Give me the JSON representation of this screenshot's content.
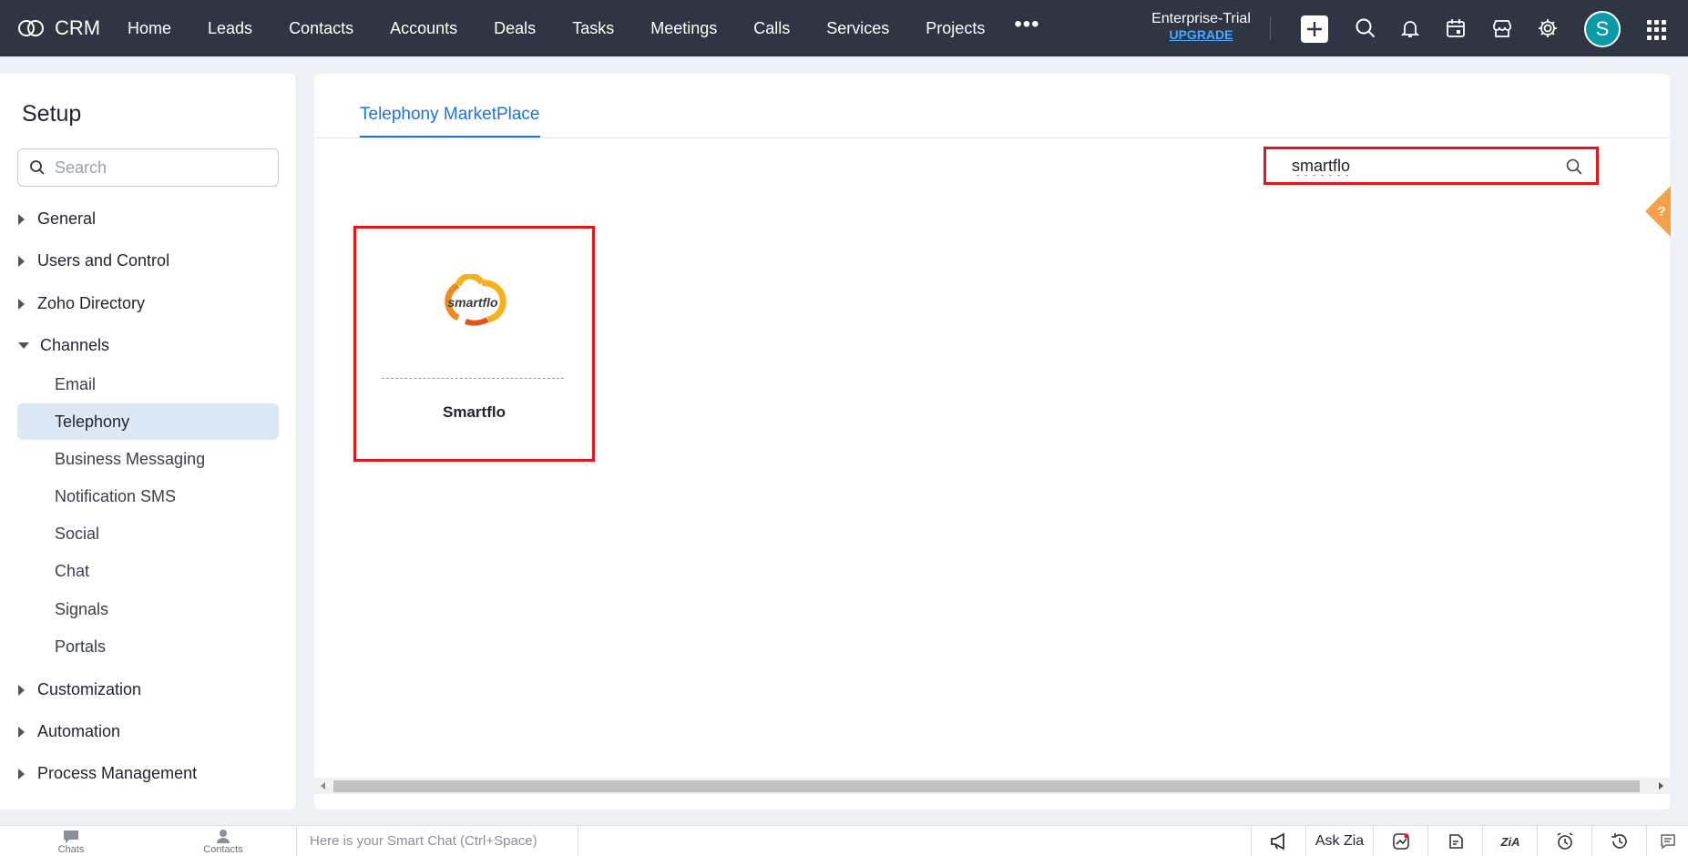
{
  "app": {
    "name": "CRM"
  },
  "nav": {
    "items": [
      "Home",
      "Leads",
      "Contacts",
      "Accounts",
      "Deals",
      "Tasks",
      "Meetings",
      "Calls",
      "Services",
      "Projects"
    ],
    "more": "•••",
    "trial_text": "Enterprise-Trial",
    "trial_link": "UPGRADE",
    "avatar_letter": "S"
  },
  "sidebar": {
    "title": "Setup",
    "search_placeholder": "Search",
    "groups": {
      "general": "General",
      "users": "Users and Control",
      "zoho": "Zoho Directory",
      "channels": "Channels",
      "customization": "Customization",
      "automation": "Automation",
      "process": "Process Management"
    },
    "channel_items": [
      "Email",
      "Telephony",
      "Business Messaging",
      "Notification SMS",
      "Social",
      "Chat",
      "Signals",
      "Portals"
    ],
    "active_item": "Telephony"
  },
  "main": {
    "tab_label": "Telephony MarketPlace",
    "search_value": "smartflo",
    "cards": [
      {
        "name": "Smartflo",
        "logo_text": "smartflo"
      }
    ]
  },
  "bottom": {
    "chats_label": "Chats",
    "contacts_label": "Contacts",
    "smartchat_placeholder": "Here is your Smart Chat (Ctrl+Space)",
    "ask_zia": "Ask Zia"
  },
  "colors": {
    "nav_bg": "#2f3543",
    "accent": "#1a73e8",
    "highlight": "#e0161b",
    "active_bg": "#dde8f6",
    "avatar": "#0a9aa8",
    "help": "#f4a14a"
  }
}
